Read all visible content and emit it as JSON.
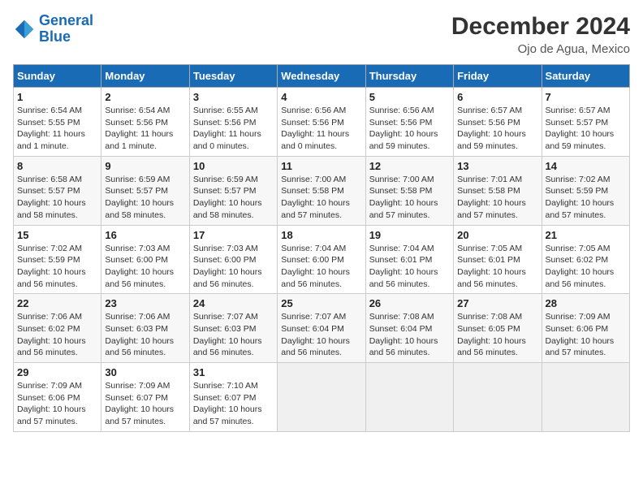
{
  "header": {
    "logo_line1": "General",
    "logo_line2": "Blue",
    "title": "December 2024",
    "subtitle": "Ojo de Agua, Mexico"
  },
  "columns": [
    "Sunday",
    "Monday",
    "Tuesday",
    "Wednesday",
    "Thursday",
    "Friday",
    "Saturday"
  ],
  "weeks": [
    [
      {
        "day": "1",
        "info": "Sunrise: 6:54 AM\nSunset: 5:55 PM\nDaylight: 11 hours and 1 minute."
      },
      {
        "day": "2",
        "info": "Sunrise: 6:54 AM\nSunset: 5:56 PM\nDaylight: 11 hours and 1 minute."
      },
      {
        "day": "3",
        "info": "Sunrise: 6:55 AM\nSunset: 5:56 PM\nDaylight: 11 hours and 0 minutes."
      },
      {
        "day": "4",
        "info": "Sunrise: 6:56 AM\nSunset: 5:56 PM\nDaylight: 11 hours and 0 minutes."
      },
      {
        "day": "5",
        "info": "Sunrise: 6:56 AM\nSunset: 5:56 PM\nDaylight: 10 hours and 59 minutes."
      },
      {
        "day": "6",
        "info": "Sunrise: 6:57 AM\nSunset: 5:56 PM\nDaylight: 10 hours and 59 minutes."
      },
      {
        "day": "7",
        "info": "Sunrise: 6:57 AM\nSunset: 5:57 PM\nDaylight: 10 hours and 59 minutes."
      }
    ],
    [
      {
        "day": "8",
        "info": "Sunrise: 6:58 AM\nSunset: 5:57 PM\nDaylight: 10 hours and 58 minutes."
      },
      {
        "day": "9",
        "info": "Sunrise: 6:59 AM\nSunset: 5:57 PM\nDaylight: 10 hours and 58 minutes."
      },
      {
        "day": "10",
        "info": "Sunrise: 6:59 AM\nSunset: 5:57 PM\nDaylight: 10 hours and 58 minutes."
      },
      {
        "day": "11",
        "info": "Sunrise: 7:00 AM\nSunset: 5:58 PM\nDaylight: 10 hours and 57 minutes."
      },
      {
        "day": "12",
        "info": "Sunrise: 7:00 AM\nSunset: 5:58 PM\nDaylight: 10 hours and 57 minutes."
      },
      {
        "day": "13",
        "info": "Sunrise: 7:01 AM\nSunset: 5:58 PM\nDaylight: 10 hours and 57 minutes."
      },
      {
        "day": "14",
        "info": "Sunrise: 7:02 AM\nSunset: 5:59 PM\nDaylight: 10 hours and 57 minutes."
      }
    ],
    [
      {
        "day": "15",
        "info": "Sunrise: 7:02 AM\nSunset: 5:59 PM\nDaylight: 10 hours and 56 minutes."
      },
      {
        "day": "16",
        "info": "Sunrise: 7:03 AM\nSunset: 6:00 PM\nDaylight: 10 hours and 56 minutes."
      },
      {
        "day": "17",
        "info": "Sunrise: 7:03 AM\nSunset: 6:00 PM\nDaylight: 10 hours and 56 minutes."
      },
      {
        "day": "18",
        "info": "Sunrise: 7:04 AM\nSunset: 6:00 PM\nDaylight: 10 hours and 56 minutes."
      },
      {
        "day": "19",
        "info": "Sunrise: 7:04 AM\nSunset: 6:01 PM\nDaylight: 10 hours and 56 minutes."
      },
      {
        "day": "20",
        "info": "Sunrise: 7:05 AM\nSunset: 6:01 PM\nDaylight: 10 hours and 56 minutes."
      },
      {
        "day": "21",
        "info": "Sunrise: 7:05 AM\nSunset: 6:02 PM\nDaylight: 10 hours and 56 minutes."
      }
    ],
    [
      {
        "day": "22",
        "info": "Sunrise: 7:06 AM\nSunset: 6:02 PM\nDaylight: 10 hours and 56 minutes."
      },
      {
        "day": "23",
        "info": "Sunrise: 7:06 AM\nSunset: 6:03 PM\nDaylight: 10 hours and 56 minutes."
      },
      {
        "day": "24",
        "info": "Sunrise: 7:07 AM\nSunset: 6:03 PM\nDaylight: 10 hours and 56 minutes."
      },
      {
        "day": "25",
        "info": "Sunrise: 7:07 AM\nSunset: 6:04 PM\nDaylight: 10 hours and 56 minutes."
      },
      {
        "day": "26",
        "info": "Sunrise: 7:08 AM\nSunset: 6:04 PM\nDaylight: 10 hours and 56 minutes."
      },
      {
        "day": "27",
        "info": "Sunrise: 7:08 AM\nSunset: 6:05 PM\nDaylight: 10 hours and 56 minutes."
      },
      {
        "day": "28",
        "info": "Sunrise: 7:09 AM\nSunset: 6:06 PM\nDaylight: 10 hours and 57 minutes."
      }
    ],
    [
      {
        "day": "29",
        "info": "Sunrise: 7:09 AM\nSunset: 6:06 PM\nDaylight: 10 hours and 57 minutes."
      },
      {
        "day": "30",
        "info": "Sunrise: 7:09 AM\nSunset: 6:07 PM\nDaylight: 10 hours and 57 minutes."
      },
      {
        "day": "31",
        "info": "Sunrise: 7:10 AM\nSunset: 6:07 PM\nDaylight: 10 hours and 57 minutes."
      },
      null,
      null,
      null,
      null
    ]
  ]
}
